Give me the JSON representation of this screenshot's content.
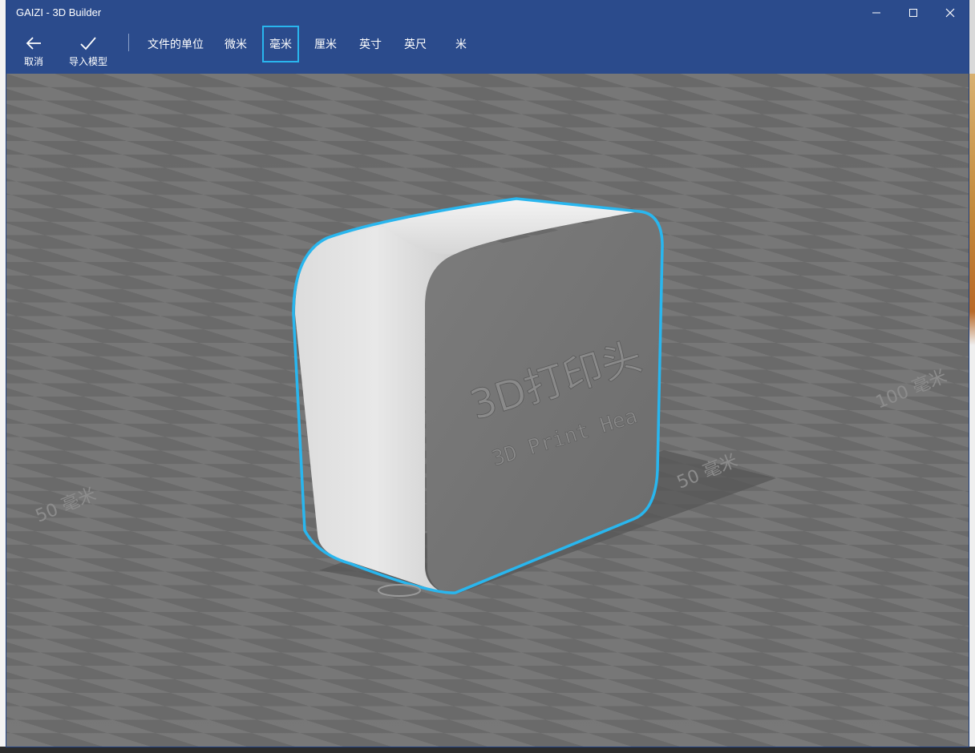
{
  "window": {
    "title": "GAIZI - 3D Builder",
    "minimize_icon": "minimize-icon",
    "maximize_icon": "maximize-icon",
    "close_icon": "close-icon"
  },
  "toolbar": {
    "cancel_label": "取消",
    "cancel_icon": "arrow-left-icon",
    "import_label": "导入模型",
    "import_icon": "checkmark-icon",
    "units_heading": "文件的单位",
    "units": [
      "微米",
      "毫米",
      "厘米",
      "英寸",
      "英尺",
      "米"
    ],
    "selected_unit": "毫米"
  },
  "viewport": {
    "model_text_cn": "3D打印头",
    "model_text_en": "3D Print Hea",
    "axis_label_left": "50 毫米",
    "axis_label_right_near": "50 毫米",
    "axis_label_right_far": "100 毫米",
    "selection_color": "#29b6ee",
    "floor_light": "#7a7a7a",
    "floor_dark": "#656565"
  }
}
